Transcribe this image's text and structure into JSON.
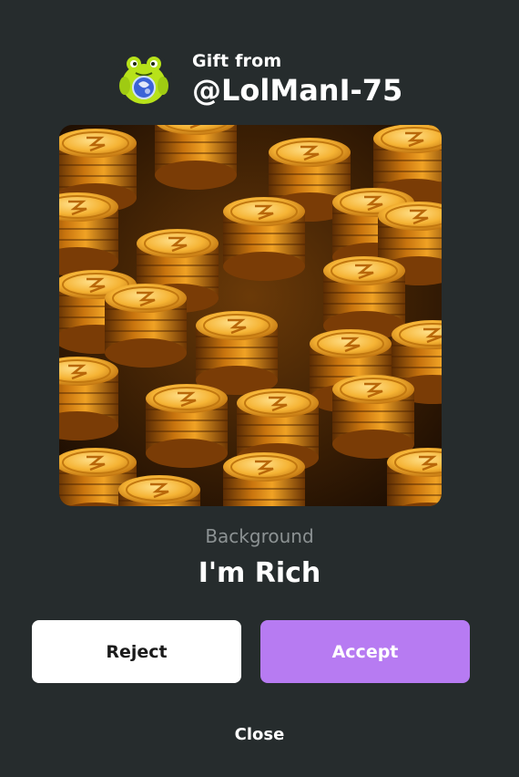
{
  "gift": {
    "from_label": "Gift from",
    "sender": "@LolManI-75"
  },
  "item": {
    "category": "Background",
    "name": "I'm Rich",
    "image_icon": "gold-coins-image"
  },
  "actions": {
    "reject_label": "Reject",
    "accept_label": "Accept",
    "close_label": "Close"
  },
  "colors": {
    "background": "#262c2d",
    "accept": "#b77bf2",
    "reject": "#ffffff",
    "muted_text": "#8c9293"
  }
}
